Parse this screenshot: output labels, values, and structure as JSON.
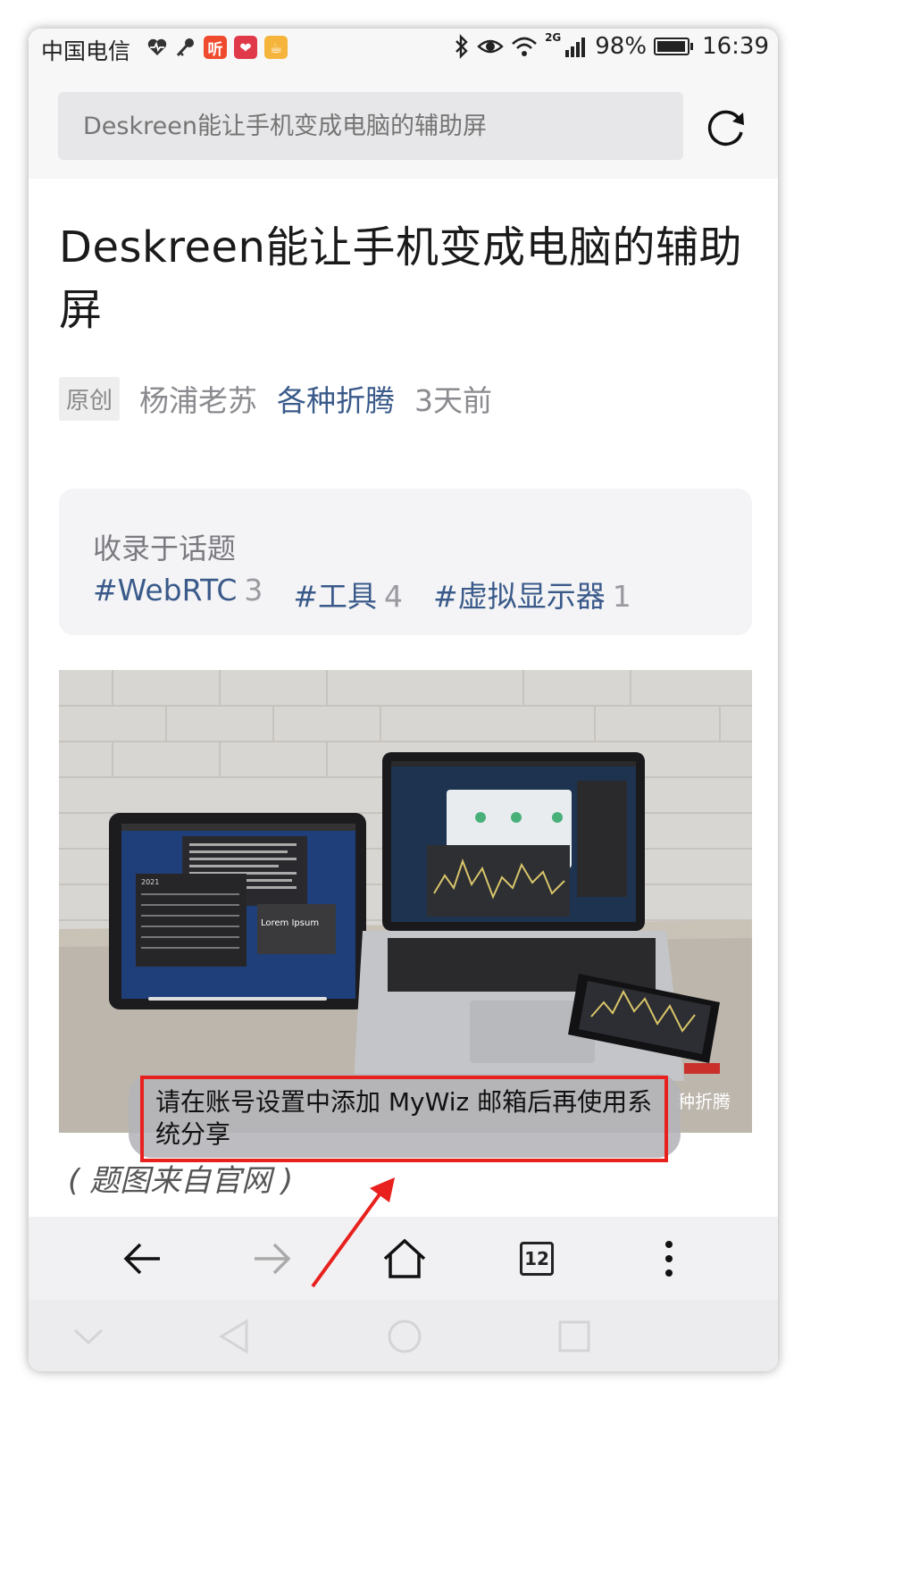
{
  "status_bar": {
    "carrier": "中国电信",
    "apps": [
      {
        "icon": "ting-app-icon",
        "glyph": "听",
        "color": "#f04a2e"
      },
      {
        "icon": "heart-grid-app-icon",
        "glyph": "❤",
        "color": "#e03a4a"
      },
      {
        "icon": "coffee-app-icon",
        "glyph": "☕",
        "color": "#f5b53c"
      }
    ],
    "network": "2G",
    "battery": "98%",
    "battery_level": 0.98,
    "time": "16:39"
  },
  "search": {
    "placeholder": "Deskreen能让手机变成电脑的辅助屏"
  },
  "article": {
    "title": "Deskreen能让手机变成电脑的辅助屏",
    "original_tag": "原创",
    "author": "杨浦老苏",
    "column": "各种折腾",
    "time": "3天前"
  },
  "topics": {
    "label": "收录于话题",
    "items": [
      {
        "name": "#WebRTC",
        "count": "3"
      },
      {
        "name": "#工具",
        "count": "4"
      },
      {
        "name": "#虚拟显示器",
        "count": "1"
      }
    ]
  },
  "hero": {
    "tablet_label": "Lorem Ipsum",
    "watermark": "种折腾",
    "calendar_year": "2021"
  },
  "caption": "( 题图来自官网 )",
  "toast": {
    "text": "请在账号设置中添加 MyWiz 邮箱后再使用系统分享"
  },
  "toolbar": {
    "tab_count": "12"
  },
  "colors": {
    "link": "#3a5a8a",
    "highlight": "#e8201e"
  }
}
